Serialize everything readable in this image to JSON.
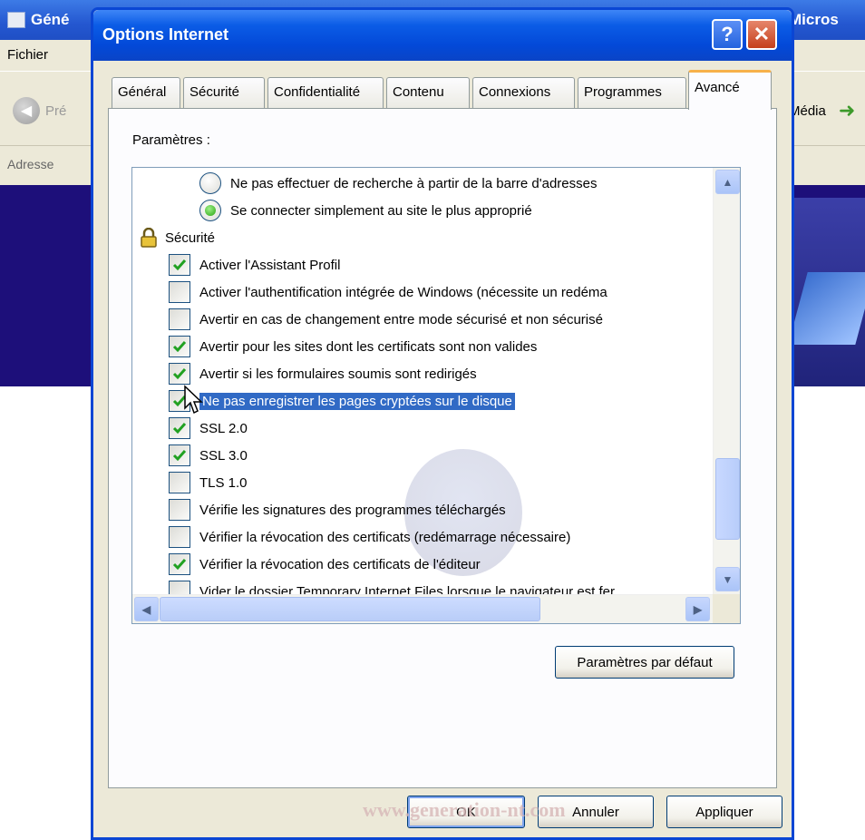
{
  "background_window": {
    "title_left": "Géné",
    "title_right": "Micros",
    "menu_file": "Fichier",
    "back_label": "Pré",
    "media_label": "Média",
    "address_label": "Adresse"
  },
  "dialog": {
    "title": "Options Internet",
    "tabs": [
      {
        "label": "Général",
        "active": false
      },
      {
        "label": "Sécurité",
        "active": false
      },
      {
        "label": "Confidentialité",
        "active": false
      },
      {
        "label": "Contenu",
        "active": false
      },
      {
        "label": "Connexions",
        "active": false
      },
      {
        "label": "Programmes",
        "active": false
      },
      {
        "label": "Avancé",
        "active": true
      }
    ],
    "params_label": "Paramètres :",
    "settings": {
      "radio_items": [
        {
          "label": "Ne pas effectuer de recherche à partir de la barre d'adresses",
          "checked": false
        },
        {
          "label": "Se connecter simplement au site le plus approprié",
          "checked": true
        }
      ],
      "group_label": "Sécurité",
      "checkbox_items": [
        {
          "label": "Activer l'Assistant Profil",
          "checked": true
        },
        {
          "label": "Activer l'authentification intégrée de Windows (nécessite un redéma",
          "checked": false
        },
        {
          "label": "Avertir en cas de changement entre mode sécurisé et non sécurisé",
          "checked": false
        },
        {
          "label": "Avertir pour les sites dont les certificats sont non valides",
          "checked": true
        },
        {
          "label": "Avertir si les formulaires soumis sont redirigés",
          "checked": true
        },
        {
          "label": "Ne pas enregistrer les pages cryptées sur le disque",
          "checked": true,
          "selected": true
        },
        {
          "label": "SSL 2.0",
          "checked": true
        },
        {
          "label": "SSL 3.0",
          "checked": true
        },
        {
          "label": "TLS 1.0",
          "checked": false
        },
        {
          "label": "Vérifie les signatures des programmes téléchargés",
          "checked": false
        },
        {
          "label": "Vérifier la révocation des certificats (redémarrage nécessaire)",
          "checked": false
        },
        {
          "label": "Vérifier la révocation des certificats de l'éditeur",
          "checked": true
        },
        {
          "label": "Vider le dossier Temporary Internet Files lorsque le navigateur est fer",
          "checked": false
        }
      ]
    },
    "defaults_button": "Paramètres par défaut",
    "buttons": {
      "ok": "OK",
      "cancel": "Annuler",
      "apply": "Appliquer"
    },
    "watermark_text": "www.generation-nt.com"
  },
  "colors": {
    "titlebar_blue": "#0349d8",
    "selection_blue": "#316ac5",
    "check_green": "#21a121",
    "dialog_face": "#ece9d8",
    "background_content": "#1d0f7a"
  },
  "icons": [
    "app-icon",
    "back-arrow-icon",
    "media-arrow-icon",
    "help-icon",
    "close-icon",
    "lock-icon",
    "checkmark-icon",
    "radio-dot-icon",
    "scroll-up-icon",
    "scroll-down-icon",
    "scroll-left-icon",
    "scroll-right-icon",
    "mouse-pointer-icon"
  ]
}
